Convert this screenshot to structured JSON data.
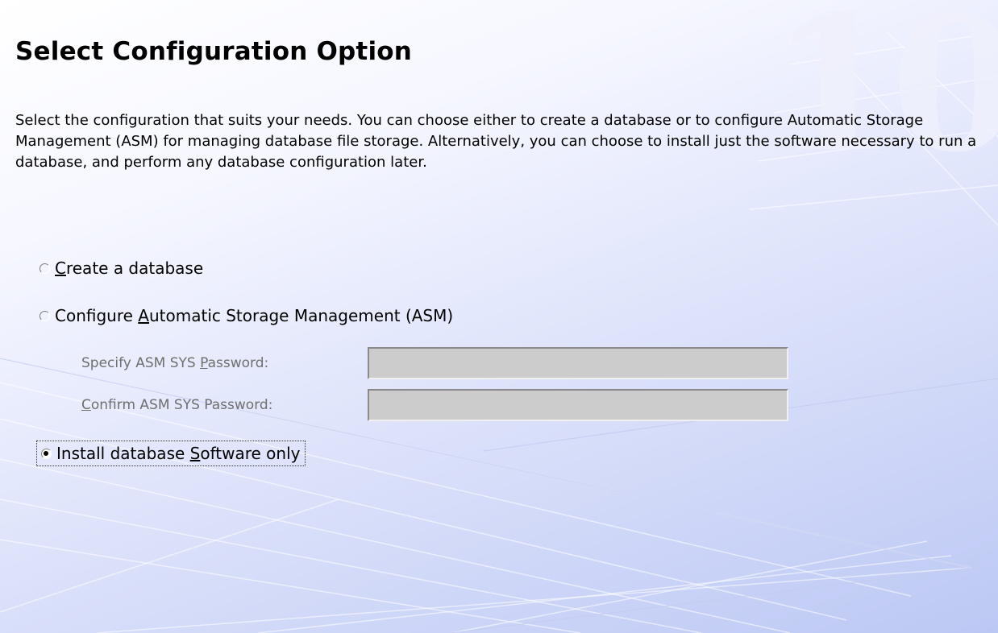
{
  "page": {
    "title": "Select Configuration Option",
    "description": "Select the configuration that suits your needs. You can choose either to create a database or to configure Automatic Storage Management (ASM) for managing database file storage. Alternatively, you can choose to install just the software necessary to run a database, and perform any database configuration later.",
    "watermark": "10g"
  },
  "options": {
    "create_db": {
      "pre": "",
      "mnemonic": "C",
      "post": "reate a database",
      "selected": false
    },
    "asm": {
      "pre": "Configure ",
      "mnemonic": "A",
      "post": "utomatic Storage Management (ASM)",
      "selected": false
    },
    "software_only": {
      "pre": "Install database ",
      "mnemonic": "S",
      "post": "oftware only",
      "selected": true
    }
  },
  "asm_fields": {
    "specify_password": {
      "pre": "Specify ASM SYS ",
      "mnemonic": "P",
      "post": "assword:",
      "value": ""
    },
    "confirm_password": {
      "pre": "",
      "mnemonic": "C",
      "post": "onfirm ASM SYS Password:",
      "value": ""
    }
  },
  "colors": {
    "background_top": "#ffffff",
    "background_bottom": "#bcc8f4",
    "disabled_text": "#6f6f6f",
    "disabled_field": "#cccccc"
  }
}
